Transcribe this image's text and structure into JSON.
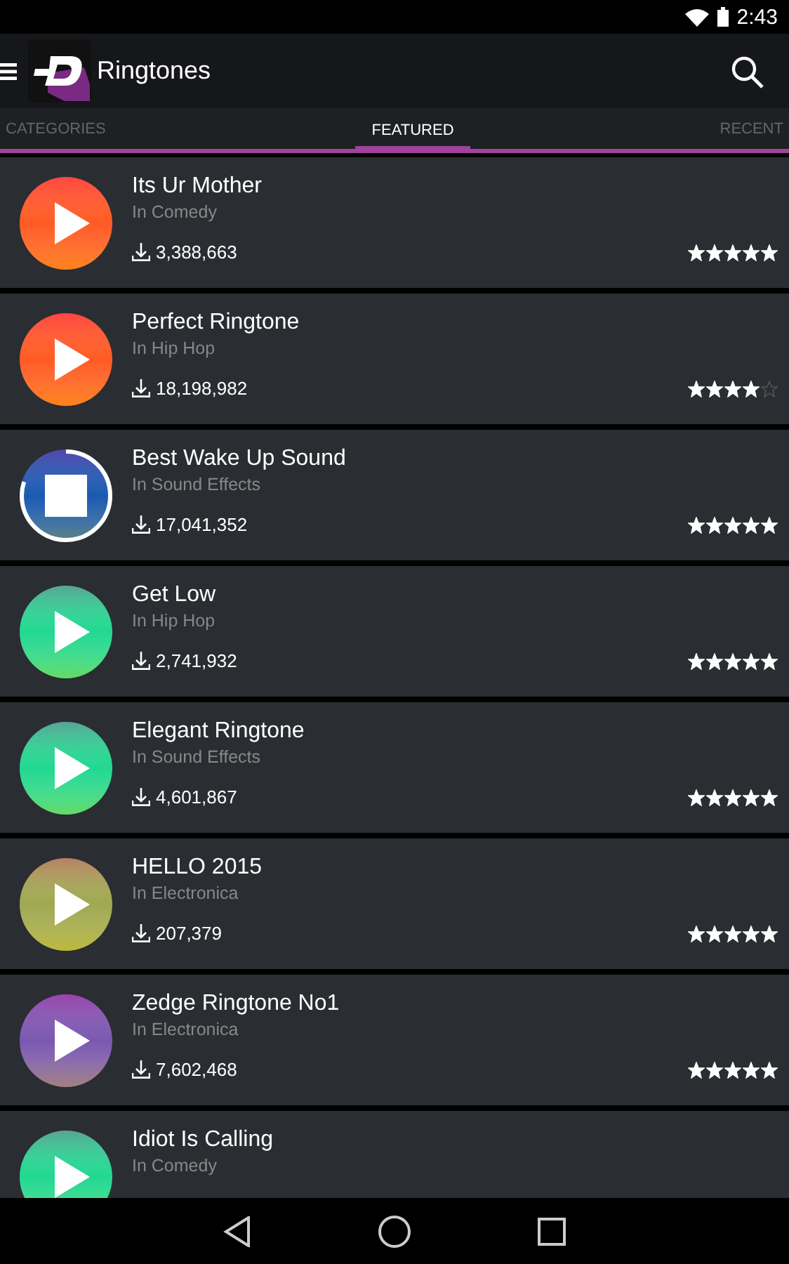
{
  "status_bar": {
    "time": "2:43"
  },
  "toolbar": {
    "title": "Ringtones"
  },
  "tabs": [
    {
      "label": "CATEGORIES",
      "selected": false
    },
    {
      "label": "FEATURED",
      "selected": true
    },
    {
      "label": "RECENT",
      "selected": false
    }
  ],
  "ringtones": [
    {
      "title": "Its Ur Mother",
      "category": "In Comedy",
      "downloads": "3,388,663",
      "stars": 5,
      "kind": "play",
      "color": "#ff5a22"
    },
    {
      "title": "Perfect Ringtone",
      "category": "In Hip Hop",
      "downloads": "18,198,982",
      "stars": 4,
      "kind": "play",
      "color": "#ff5a22"
    },
    {
      "title": "Best Wake Up Sound",
      "category": "In Sound Effects",
      "downloads": "17,041,352",
      "stars": 5,
      "kind": "stop",
      "level": 0.8,
      "color": "#1a5ab0"
    },
    {
      "title": "Get Low",
      "category": "In Hip Hop",
      "downloads": "2,741,932",
      "stars": 5,
      "kind": "play",
      "color": "#22d890"
    },
    {
      "title": "Elegant Ringtone",
      "category": "In Sound Effects",
      "downloads": "4,601,867",
      "stars": 5,
      "kind": "play",
      "color": "#22d890"
    },
    {
      "title": "HELLO 2015",
      "category": "In Electronica",
      "downloads": "207,379",
      "stars": 5,
      "kind": "play",
      "color": "#a0a850"
    },
    {
      "title": "Zedge Ringtone No1",
      "category": "In Electronica",
      "downloads": "7,602,468",
      "stars": 5,
      "kind": "play",
      "color": "#7a58b0"
    },
    {
      "title": "Idiot Is Calling",
      "category": "In Comedy",
      "kind": "play",
      "color": "#22d890"
    }
  ]
}
